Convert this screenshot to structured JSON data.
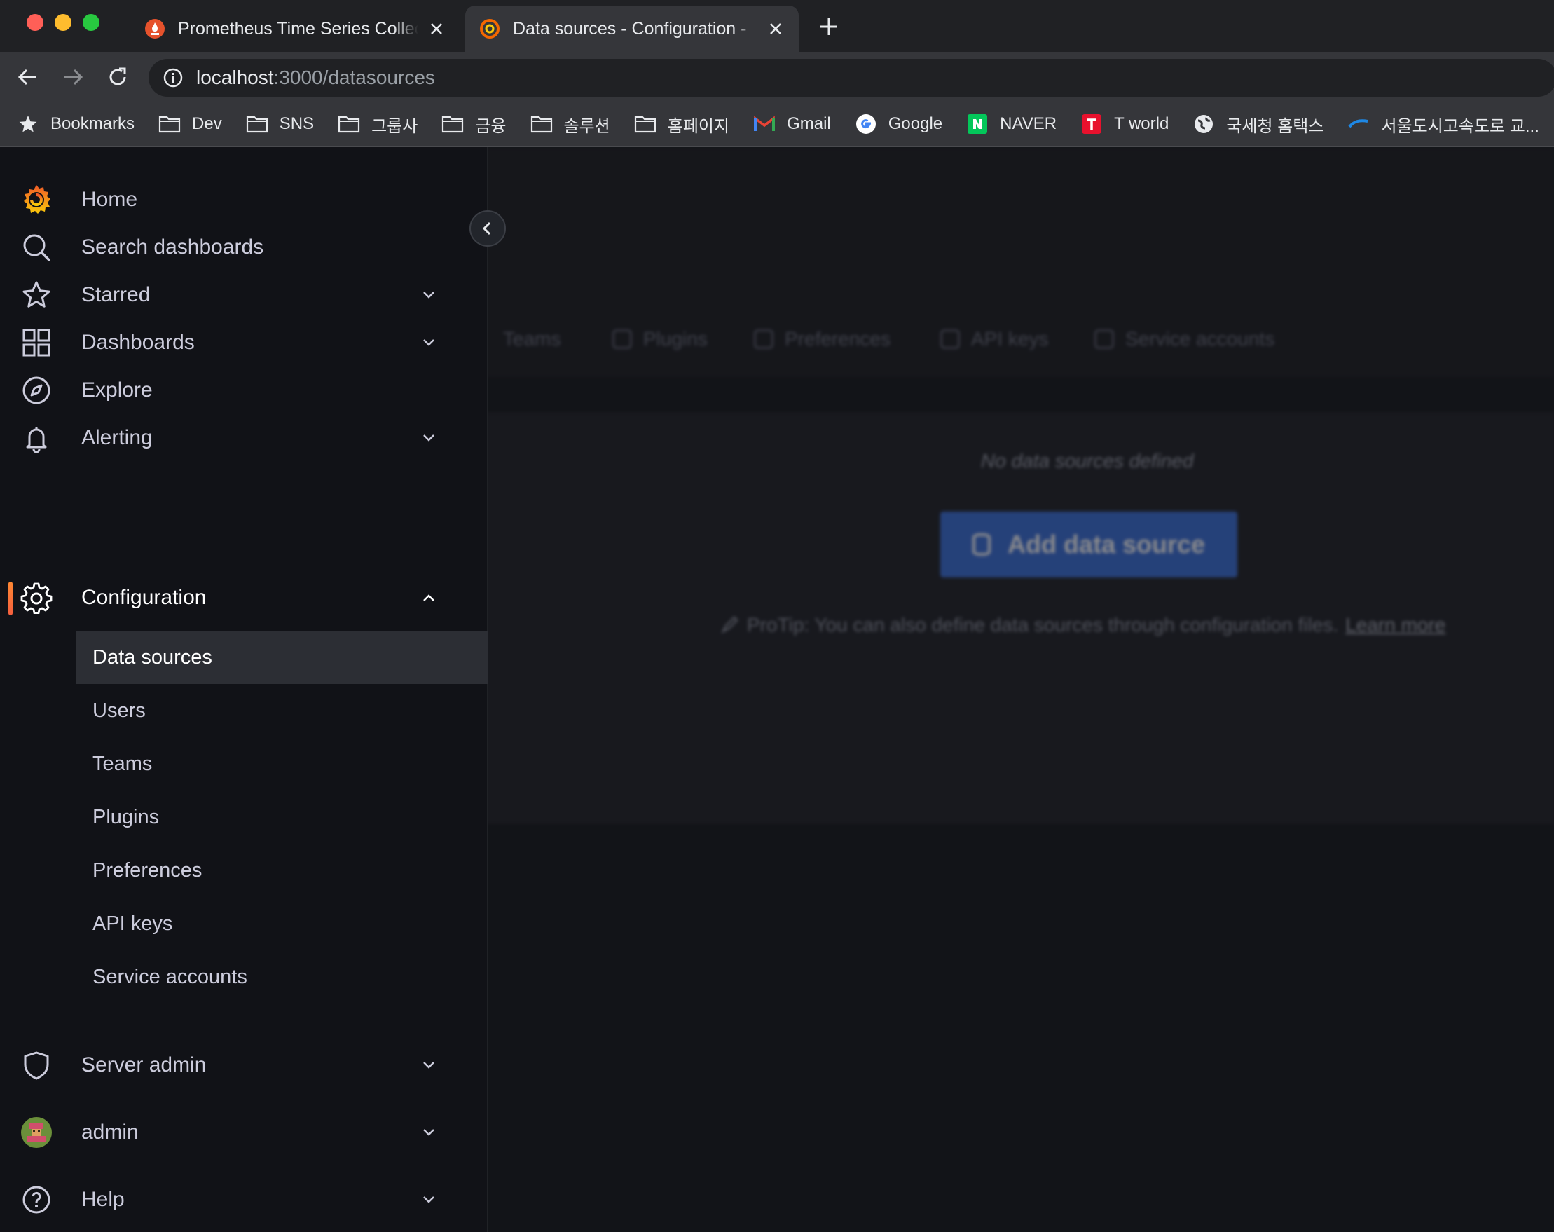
{
  "browser": {
    "tabs": [
      {
        "title": "Prometheus Time Series Collec",
        "active": false
      },
      {
        "title": "Data sources - Configuration -",
        "active": true
      }
    ],
    "url_host": "localhost",
    "url_path": ":3000/datasources",
    "bookmarks": [
      {
        "label": "Bookmarks",
        "icon": "star-icon"
      },
      {
        "label": "Dev",
        "icon": "folder-icon"
      },
      {
        "label": "SNS",
        "icon": "folder-icon"
      },
      {
        "label": "그룹사",
        "icon": "folder-icon"
      },
      {
        "label": "금융",
        "icon": "folder-icon"
      },
      {
        "label": "솔루션",
        "icon": "folder-icon"
      },
      {
        "label": "홈페이지",
        "icon": "folder-icon"
      },
      {
        "label": "Gmail",
        "icon": "gmail-icon"
      },
      {
        "label": "Google",
        "icon": "google-icon"
      },
      {
        "label": "NAVER",
        "icon": "naver-icon"
      },
      {
        "label": "T world",
        "icon": "tworld-icon"
      },
      {
        "label": "국세청 홈택스",
        "icon": "globe-icon"
      },
      {
        "label": "서울도시고속도로 교...",
        "icon": "wave-icon"
      }
    ]
  },
  "sidemenu": {
    "items": [
      {
        "label": "Home",
        "icon": "grafana-logo-icon"
      },
      {
        "label": "Search dashboards",
        "icon": "search-icon"
      },
      {
        "label": "Starred",
        "icon": "star-icon"
      },
      {
        "label": "Dashboards",
        "icon": "apps-icon"
      },
      {
        "label": "Explore",
        "icon": "compass-icon"
      },
      {
        "label": "Alerting",
        "icon": "bell-icon"
      },
      {
        "label": "Configuration",
        "icon": "cog-icon"
      },
      {
        "label": "Server admin",
        "icon": "shield-icon"
      },
      {
        "label": "admin",
        "icon": "avatar-icon"
      },
      {
        "label": "Help",
        "icon": "question-icon"
      }
    ],
    "config_subitems": [
      "Data sources",
      "Users",
      "Teams",
      "Plugins",
      "Preferences",
      "API keys",
      "Service accounts"
    ],
    "selected_subitem": "Data sources"
  },
  "main": {
    "tabs": [
      "Teams",
      "Plugins",
      "Preferences",
      "API keys",
      "Service accounts"
    ],
    "empty_message": "No data sources defined",
    "add_button": "Add data source",
    "protip": "ProTip: You can also define data sources through configuration files.",
    "learn_more": "Learn more"
  },
  "colors": {
    "accent_orange": "#f55f3e",
    "primary_blue": "#3d71d9"
  }
}
